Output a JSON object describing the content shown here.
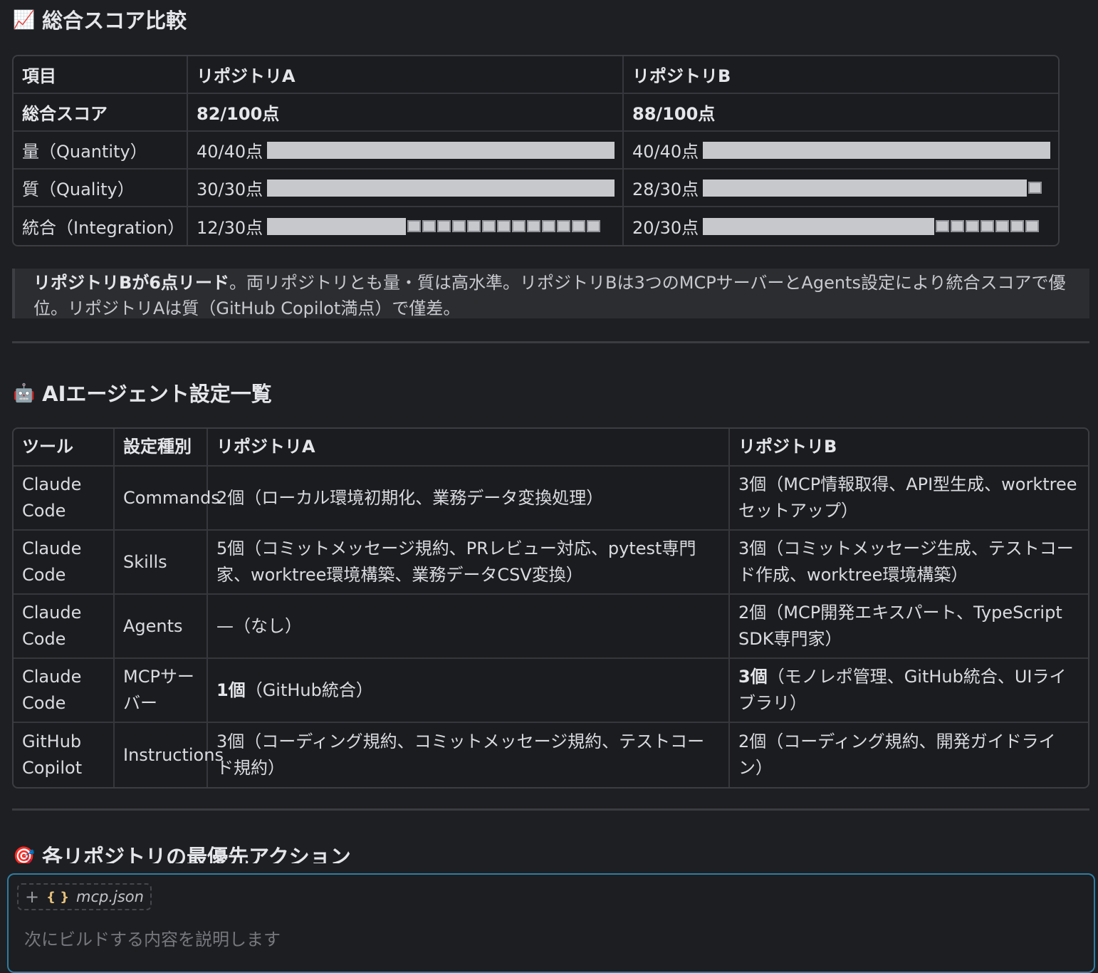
{
  "section1": {
    "emoji": "📈",
    "title": "総合スコア比較"
  },
  "score_table": {
    "headers": [
      "項目",
      "リポジトリA",
      "リポジトリB"
    ],
    "total": {
      "label": "総合スコア",
      "a": "82/100点",
      "b": "88/100点"
    },
    "rows": [
      {
        "label": "量（Quantity）",
        "a": {
          "text": "40/40点",
          "ratio": 1.0
        },
        "b": {
          "text": "40/40点",
          "ratio": 1.0
        }
      },
      {
        "label": "質（Quality）",
        "a": {
          "text": "30/30点",
          "ratio": 1.0
        },
        "b": {
          "text": "28/30点",
          "ratio": 0.933
        }
      },
      {
        "label": "統合（Integration）",
        "a": {
          "text": "12/30点",
          "ratio": 0.4
        },
        "b": {
          "text": "20/30点",
          "ratio": 0.667
        }
      }
    ]
  },
  "summary": {
    "lead": "リポジトリBが6点リード",
    "rest": "。両リポジトリとも量・質は高水準。リポジトリBは3つのMCPサーバーとAgents設定により統合スコアで優位。リポジトリAは質（GitHub Copilot満点）で僅差。"
  },
  "section2": {
    "emoji": "🤖",
    "title": "AIエージェント設定一覧"
  },
  "agent_table": {
    "headers": [
      "ツール",
      "設定種別",
      "リポジトリA",
      "リポジトリB"
    ],
    "rows": [
      {
        "tool": "Claude Code",
        "kind": "Commands",
        "a": "2個（ローカル環境初期化、業務データ変換処理）",
        "b": "3個（MCP情報取得、API型生成、worktreeセットアップ）"
      },
      {
        "tool": "Claude Code",
        "kind": "Skills",
        "a": "5個（コミットメッセージ規約、PRレビュー対応、pytest専門家、worktree環境構築、業務データCSV変換）",
        "b": "3個（コミットメッセージ生成、テストコード作成、worktree環境構築）"
      },
      {
        "tool": "Claude Code",
        "kind": "Agents",
        "a": "—（なし）",
        "b": "2個（MCP開発エキスパート、TypeScript SDK専門家）"
      },
      {
        "tool": "Claude Code",
        "kind": "MCPサーバー",
        "a_bold": "1個",
        "a": "（GitHub統合）",
        "b_bold": "3個",
        "b": "（モノレポ管理、GitHub統合、UIライブラリ）"
      },
      {
        "tool": "GitHub Copilot",
        "kind": "Instructions",
        "a": "3個（コーディング規約、コミットメッセージ規約、テストコード規約）",
        "b": "2個（コーディング規約、開発ガイドライン）"
      }
    ]
  },
  "section3": {
    "emoji": "🎯",
    "title": "各リポジトリの最優先アクション"
  },
  "composer": {
    "attachment": "mcp.json",
    "placeholder": "次にビルドする内容を説明します"
  }
}
